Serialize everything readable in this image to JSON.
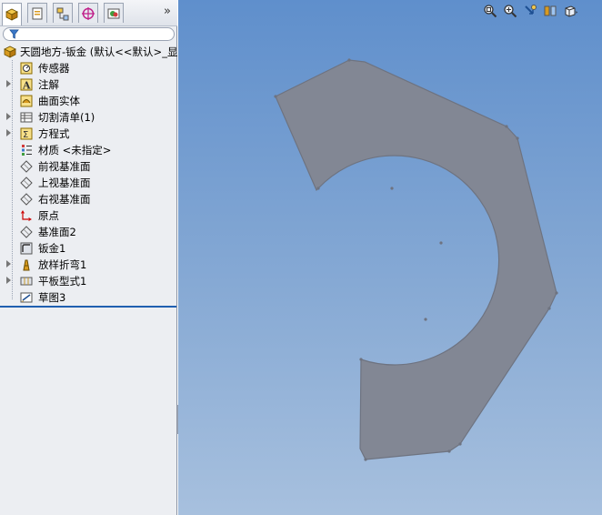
{
  "panel": {
    "tabs": [
      {
        "name": "featuremanager-tab-icon",
        "active": true
      },
      {
        "name": "propertymanager-tab-icon",
        "active": false
      },
      {
        "name": "configurationmanager-tab-icon",
        "active": false
      },
      {
        "name": "dimxpert-tab-icon",
        "active": false
      },
      {
        "name": "display-manager-tab-icon",
        "active": false
      }
    ],
    "more_label": "»",
    "tree": [
      {
        "label": "天圆地方-钣金 (默认<<默认>_显",
        "icon": "part-icon",
        "root": true,
        "expander": false
      },
      {
        "label": "传感器",
        "icon": "sensor-icon",
        "expander": false
      },
      {
        "label": "注解",
        "icon": "annotation-icon",
        "expander": true
      },
      {
        "label": "曲面实体",
        "icon": "surface-body-icon",
        "expander": false
      },
      {
        "label": "切割清单(1)",
        "icon": "cut-list-icon",
        "expander": true
      },
      {
        "label": "方程式",
        "icon": "equation-icon",
        "expander": true
      },
      {
        "label": "材质 <未指定>",
        "icon": "material-icon",
        "expander": false
      },
      {
        "label": "前视基准面",
        "icon": "plane-icon",
        "expander": false
      },
      {
        "label": "上视基准面",
        "icon": "plane-icon",
        "expander": false
      },
      {
        "label": "右视基准面",
        "icon": "plane-icon",
        "expander": false
      },
      {
        "label": "原点",
        "icon": "origin-icon",
        "expander": false
      },
      {
        "label": "基准面2",
        "icon": "plane-icon",
        "expander": false
      },
      {
        "label": "钣金1",
        "icon": "sheet-metal-icon",
        "expander": false
      },
      {
        "label": "放样折弯1",
        "icon": "lofted-bend-icon",
        "expander": true
      },
      {
        "label": "平板型式1",
        "icon": "flat-pattern-icon",
        "expander": true
      },
      {
        "label": "草图3",
        "icon": "sketch-icon",
        "expander": false
      }
    ]
  },
  "viewport": {
    "toolbar": [
      "zoom-to-fit-icon",
      "zoom-to-area-icon",
      "previous-view-icon",
      "section-view-icon",
      "view-orientation-icon"
    ],
    "colors": {
      "part": "#828794",
      "edge": "#6e7380",
      "bg_top": "#5f8fcc",
      "bg_bottom": "#a7c0de"
    }
  }
}
